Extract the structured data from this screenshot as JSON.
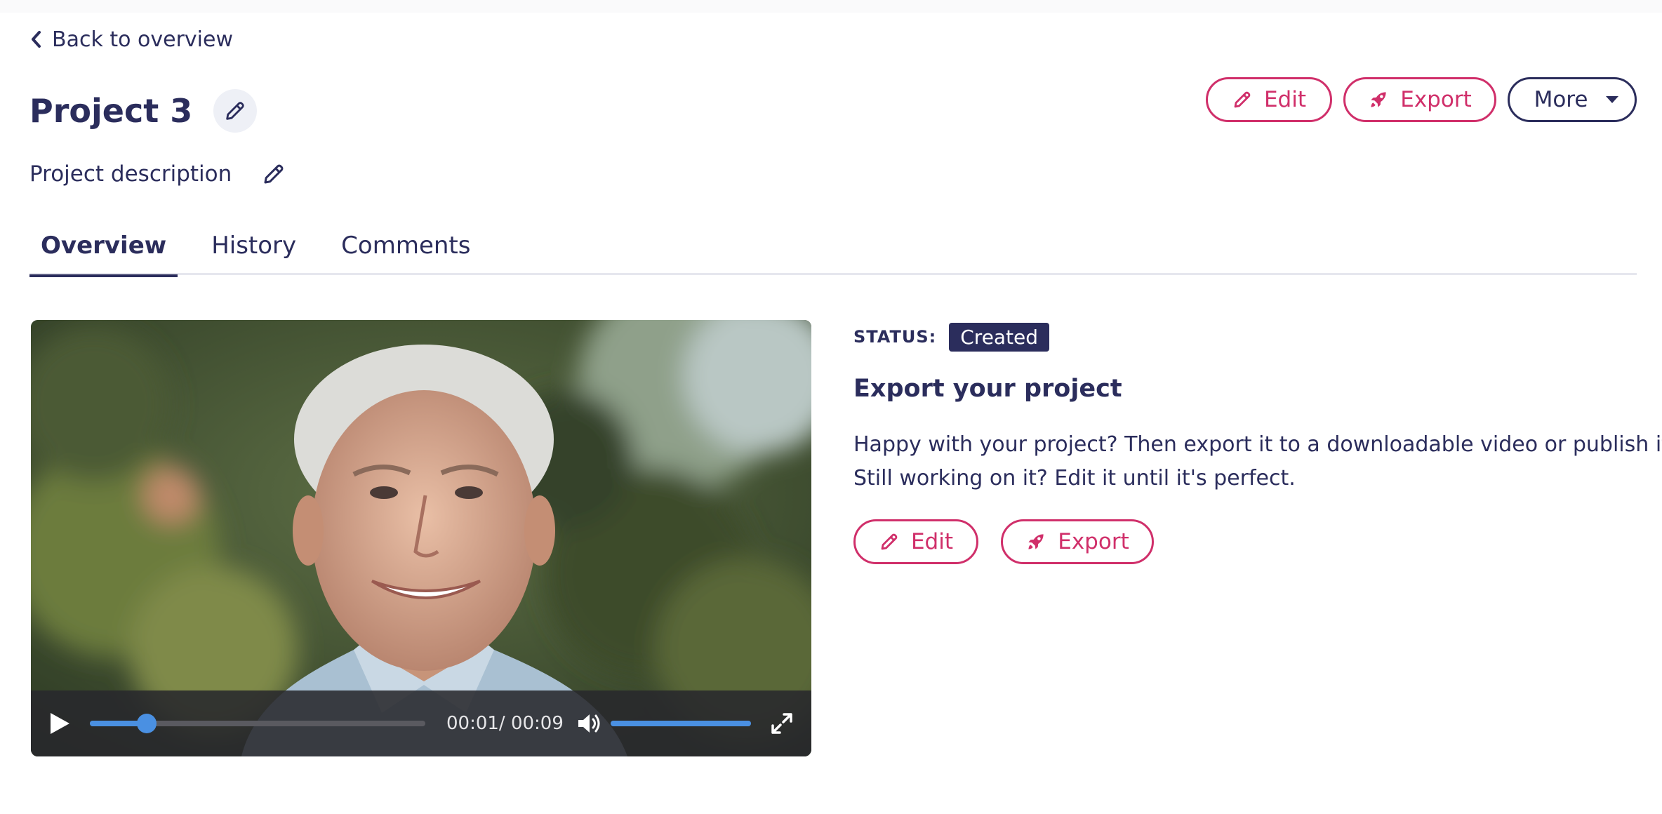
{
  "nav": {
    "back_label": "Back to overview"
  },
  "project": {
    "title": "Project 3",
    "description": "Project description"
  },
  "header_actions": {
    "edit_label": "Edit",
    "export_label": "Export",
    "more_label": "More"
  },
  "tabs": [
    {
      "label": "Overview",
      "active": true
    },
    {
      "label": "History",
      "active": false
    },
    {
      "label": "Comments",
      "active": false
    }
  ],
  "video": {
    "time_label": "00:01/ 00:09",
    "progress": 0.17,
    "volume": 1.0
  },
  "status": {
    "label": "STATUS:",
    "value": "Created"
  },
  "export_panel": {
    "title": "Export your project",
    "line1": "Happy with your project? Then export it to a downloadable video or publish it.",
    "line2": "Still working on it? Edit it until it's perfect.",
    "edit_label": "Edit",
    "export_label": "Export"
  },
  "colors": {
    "navy": "#2b2d5c",
    "accent": "#d02f6a",
    "player_blue": "#4a90e2"
  }
}
